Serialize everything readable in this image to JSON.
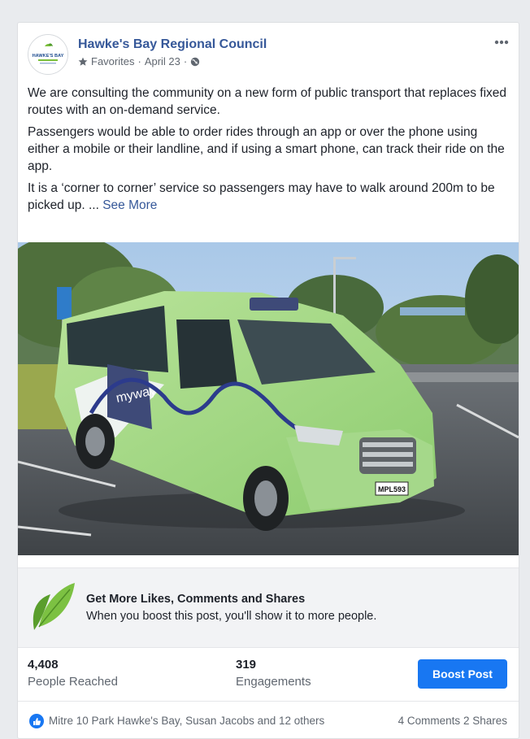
{
  "post": {
    "page_name": "Hawke's Bay Regional Council",
    "avatar_text": "HAWKE'S BAY",
    "favorites_label": "Favorites",
    "date": "April 23",
    "separator": "·",
    "more_icon": "more-dots-icon",
    "paragraphs": [
      "We are consulting the community on a new form of public transport that replaces fixed routes with an on-demand service.",
      "Passengers would be able to order rides through an app or over the phone using either a mobile or their landline, and if using a smart phone, can track their ride on the app.",
      "It is a ‘corner to corner’ service so passengers may have to walk around 200m to be picked up. ..."
    ],
    "see_more": "See More"
  },
  "photo": {
    "brand_text": "myway",
    "plate": "MPL593"
  },
  "boost": {
    "title": "Get More Likes, Comments and Shares",
    "subtitle": "When you boost this post, you'll show it to more people."
  },
  "stats": {
    "reached_value": "4,408",
    "reached_label": "People Reached",
    "engagements_value": "319",
    "engagements_label": "Engagements",
    "boost_button": "Boost Post"
  },
  "footer": {
    "reactors": "Mitre 10 Park Hawke's Bay, Susan Jacobs and 12 others",
    "comments": "4 Comments",
    "shares": "2 Shares"
  },
  "colors": {
    "link": "#365899",
    "button": "#1877f2",
    "leaf": "#6aaa2a"
  }
}
